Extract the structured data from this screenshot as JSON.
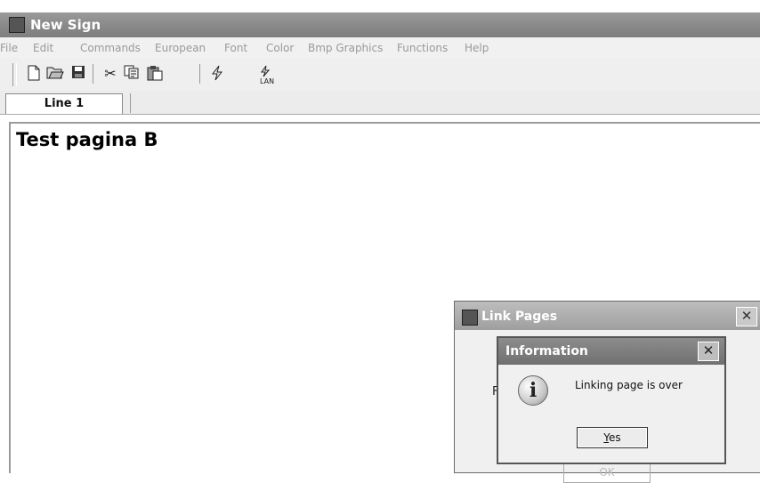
{
  "window": {
    "title": "New Sign"
  },
  "menu": [
    "File",
    "Edit",
    "Commands",
    "European",
    "Font",
    "Color",
    "Bmp Graphics",
    "Functions",
    "Help"
  ],
  "toolbar": {
    "icons": [
      "new-document-icon",
      "open-folder-icon",
      "save-disk-icon",
      "cut-scissors-icon",
      "copy-icon",
      "paste-icon",
      "lightning-icon",
      "lan-icon"
    ]
  },
  "tabs": [
    {
      "label": "Line 1"
    }
  ],
  "editor": {
    "text": "Test pagina B"
  },
  "link_pages": {
    "title": "Link Pages",
    "close": "✕",
    "partial_label": "F",
    "ok_label": "OK"
  },
  "info_dialog": {
    "title": "Information",
    "close": "✕",
    "message": "Linking page is over",
    "icon_glyph": "i",
    "yes_first": "Y",
    "yes_rest": "es"
  }
}
